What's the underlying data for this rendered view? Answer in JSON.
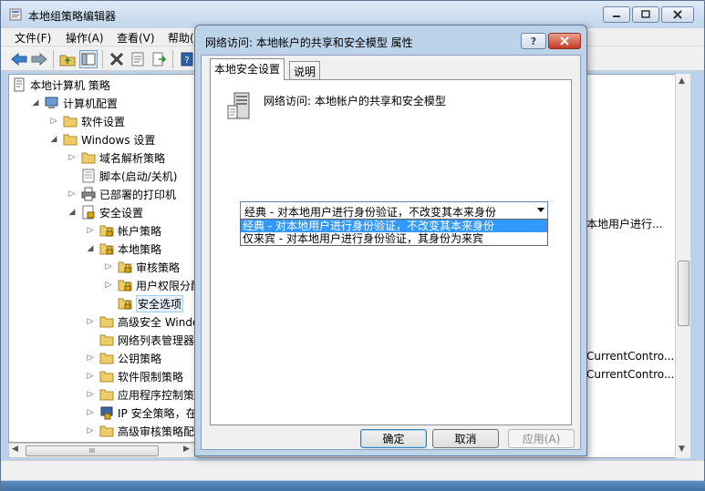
{
  "main_window": {
    "title": "本地组策略编辑器",
    "menu": [
      "文件(F)",
      "操作(A)",
      "查看(V)",
      "帮助("
    ]
  },
  "tree": {
    "items": [
      {
        "label": "本地计算机 策略",
        "level": 0,
        "arrow": "",
        "icon": "computer-policy-icon"
      },
      {
        "label": "计算机配置",
        "level": 1,
        "arrow": "expanded",
        "icon": "computer-icon"
      },
      {
        "label": "软件设置",
        "level": 2,
        "arrow": "collapsed",
        "icon": "folder-icon"
      },
      {
        "label": "Windows 设置",
        "level": 2,
        "arrow": "expanded",
        "icon": "folder-icon"
      },
      {
        "label": "域名解析策略",
        "level": 3,
        "arrow": "collapsed",
        "icon": "folder-icon"
      },
      {
        "label": "脚本(启动/关机)",
        "level": 3,
        "arrow": "",
        "icon": "script-icon"
      },
      {
        "label": "已部署的打印机",
        "level": 3,
        "arrow": "collapsed",
        "icon": "printer-icon"
      },
      {
        "label": "安全设置",
        "level": 3,
        "arrow": "expanded",
        "icon": "security-settings-icon"
      },
      {
        "label": "帐户策略",
        "level": 4,
        "arrow": "collapsed",
        "icon": "lock-folder-icon"
      },
      {
        "label": "本地策略",
        "level": 4,
        "arrow": "expanded",
        "icon": "lock-folder-icon"
      },
      {
        "label": "审核策略",
        "level": 5,
        "arrow": "collapsed",
        "icon": "lock-folder-icon"
      },
      {
        "label": "用户权限分配",
        "level": 5,
        "arrow": "collapsed",
        "icon": "lock-folder-icon"
      },
      {
        "label": "安全选项",
        "level": 5,
        "arrow": "",
        "icon": "lock-folder-icon",
        "selected": true
      },
      {
        "label": "高级安全 Windows",
        "level": 4,
        "arrow": "collapsed",
        "icon": "folder-icon"
      },
      {
        "label": "网络列表管理器策略",
        "level": 4,
        "arrow": "",
        "icon": "folder-icon"
      },
      {
        "label": "公钥策略",
        "level": 4,
        "arrow": "collapsed",
        "icon": "folder-icon"
      },
      {
        "label": "软件限制策略",
        "level": 4,
        "arrow": "collapsed",
        "icon": "folder-icon"
      },
      {
        "label": "应用程序控制策略",
        "level": 4,
        "arrow": "collapsed",
        "icon": "folder-icon"
      },
      {
        "label": "IP 安全策略，在 本",
        "level": 4,
        "arrow": "collapsed",
        "icon": "ip-security-icon"
      },
      {
        "label": "高级审核策略配置",
        "level": 4,
        "arrow": "collapsed",
        "icon": "folder-icon"
      }
    ],
    "hscroll_thumb": "III"
  },
  "right_pane": {
    "row1": "本地用户进行...",
    "row2": "CurrentContro...",
    "row3": "CurrentContro..."
  },
  "dialog": {
    "title": "网络访问: 本地帐户的共享和安全模型 属性",
    "tabs": [
      "本地安全设置",
      "说明"
    ],
    "policy_name": "网络访问: 本地帐户的共享和安全模型",
    "selected_value": "经典 - 对本地用户进行身份验证，不改变其本来身份",
    "options": [
      "经典 - 对本地用户进行身份验证，不改变其本来身份",
      "仅来宾 - 对本地用户进行身份验证，其身份为来宾"
    ],
    "buttons": {
      "ok": "确定",
      "cancel": "取消",
      "apply": "应用(A)"
    }
  }
}
